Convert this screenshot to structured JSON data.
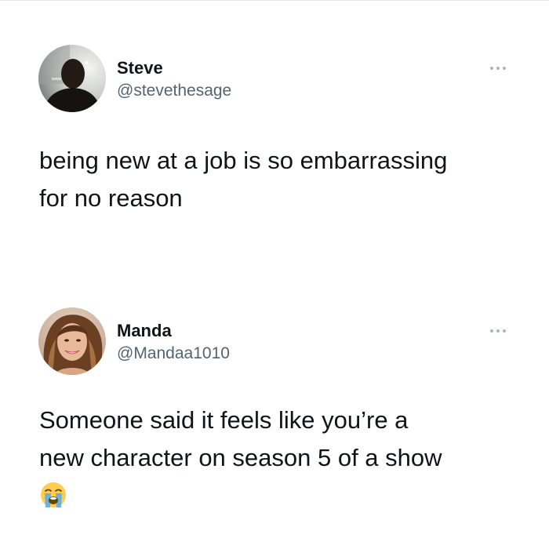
{
  "tweets": [
    {
      "name": "Steve",
      "handle": "@stevethesage",
      "text_lines": [
        "being new at a job is so embarrassing",
        "for no reason"
      ],
      "avatar": "profile-photo-dark",
      "menu_icon": "more-options-icon"
    },
    {
      "name": "Manda",
      "handle": "@Mandaa1010",
      "text_lines": [
        "Someone said it feels like you’re a",
        "new character on season 5 of a show"
      ],
      "emoji": "loudly-crying-face",
      "avatar": "profile-photo-smiling-woman",
      "menu_icon": "more-options-icon"
    }
  ],
  "colors": {
    "name": "#0f1419",
    "handle": "#536471",
    "text": "#0f1419",
    "dots": "#aab8c2"
  }
}
